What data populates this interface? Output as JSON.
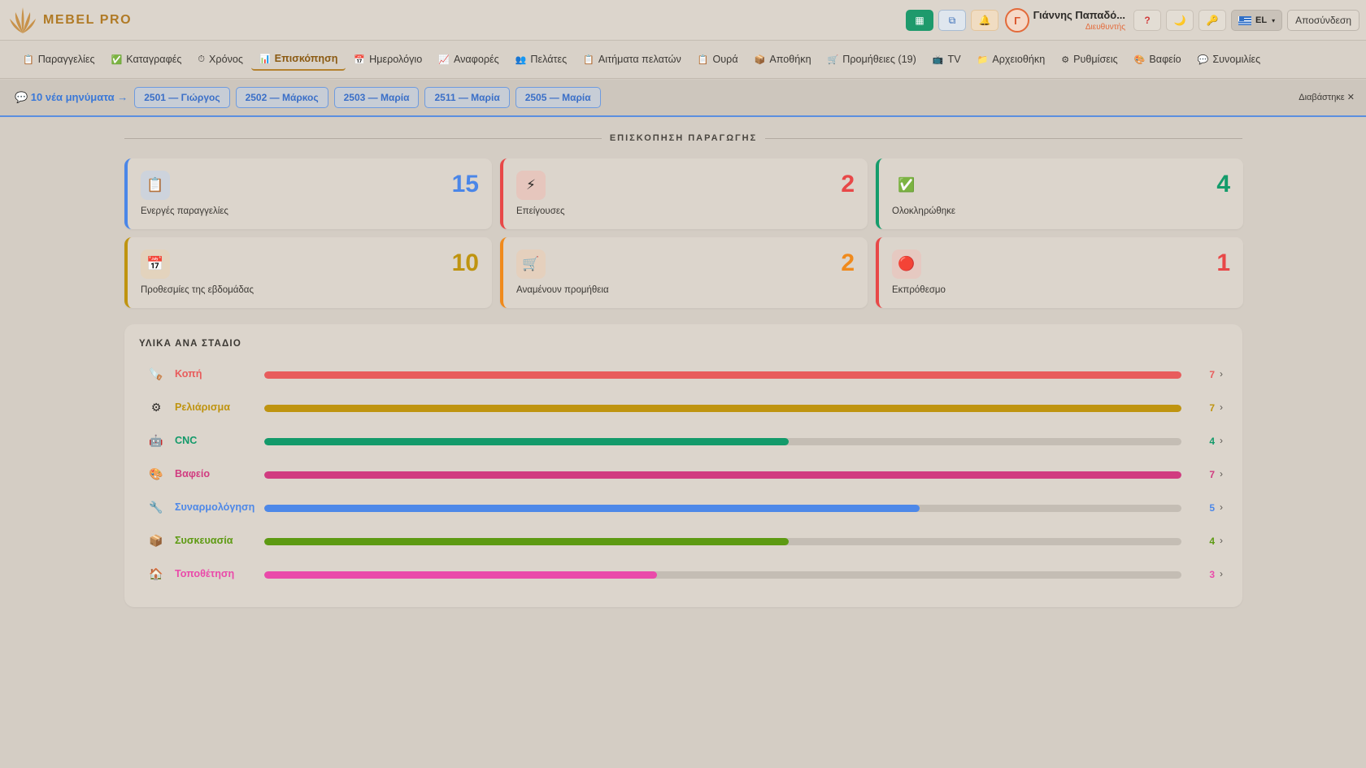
{
  "app": {
    "brand": "MEBEL PRO"
  },
  "header": {
    "buttons": [
      {
        "name": "shortcut-green-icon",
        "glyph": "▦"
      },
      {
        "name": "shortcut-blue-icon",
        "glyph": "⧉"
      },
      {
        "name": "notifications-icon",
        "glyph": "🔔"
      }
    ],
    "avatar_initial": "Γ",
    "user_name": "Γιάννης Παπαδό...",
    "user_role": "Διευθυντής",
    "help_glyph": "?",
    "theme_glyph": "🌙",
    "tools_glyph": "🔑",
    "lang": "EL",
    "logout": "Αποσύνδεση"
  },
  "nav": {
    "items": [
      {
        "label": "Παραγγελίες",
        "icon": "📋"
      },
      {
        "label": "Καταγραφές",
        "icon": "✅"
      },
      {
        "label": "Χρόνος",
        "icon": "⏱"
      },
      {
        "label": "Επισκόπηση",
        "icon": "📊"
      },
      {
        "label": "Ημερολόγιο",
        "icon": "📅"
      },
      {
        "label": "Αναφορές",
        "icon": "📈"
      },
      {
        "label": "Πελάτες",
        "icon": "👥"
      },
      {
        "label": "Αιτήματα πελατών",
        "icon": "📋"
      },
      {
        "label": "Ουρά",
        "icon": "📋"
      },
      {
        "label": "Αποθήκη",
        "icon": "📦"
      },
      {
        "label": "Προμήθειες (19)",
        "icon": "🛒"
      },
      {
        "label": "TV",
        "icon": "📺"
      },
      {
        "label": "Αρχειοθήκη",
        "icon": "📁"
      },
      {
        "label": "Ρυθμίσεις",
        "icon": "⚙"
      },
      {
        "label": "Βαφείο",
        "icon": "🎨"
      },
      {
        "label": "Συνομιλίες",
        "icon": "💬"
      }
    ],
    "active_index": 3
  },
  "messages": {
    "count_label": "💬 10 νέα μηνύματα →",
    "chips": [
      "2501 — Γιώργος",
      "2502 — Μάρκος",
      "2503 — Μαρία",
      "2511 — Μαρία",
      "2505 — Μαρία"
    ],
    "dismiss": "Διαβάστηκε ✕"
  },
  "overview": {
    "title": "ΕΠΙΣΚΟΠΗΣΗ ΠΑΡΑΓΩΓΗΣ",
    "cards": [
      {
        "label": "Ενεργές παραγγελίες",
        "value": "15",
        "icon": "📋",
        "color": "#4a86e8",
        "bg": "#cdd3dc"
      },
      {
        "label": "Επείγουσες",
        "value": "2",
        "icon": "⚡",
        "color": "#e84848",
        "bg": "#e6c6bd"
      },
      {
        "label": "Ολοκληρώθηκε",
        "value": "4",
        "icon": "✅",
        "color": "#149c6b",
        "bg": "#dcd5cc"
      },
      {
        "label": "Προθεσμίες της εβδομάδας",
        "value": "10",
        "icon": "📅",
        "color": "#bf9410",
        "bg": "#e3d3bd"
      },
      {
        "label": "Αναμένουν προμήθεια",
        "value": "2",
        "icon": "🛒",
        "color": "#f08a1c",
        "bg": "#e5d0bd"
      },
      {
        "label": "Εκπρόθεσμο",
        "value": "1",
        "icon": "🔴",
        "color": "#e84848",
        "bg": "#e6c9c1"
      }
    ]
  },
  "stages": {
    "title": "ΥΛΙΚΑ ΑΝΑ ΣΤΑΔΙΟ",
    "max": 7,
    "rows": [
      {
        "name": "Κοπή",
        "icon": "🪚",
        "count": 7,
        "color": "#e85c5c"
      },
      {
        "name": "Ρελιάρισμα",
        "icon": "⚙",
        "count": 7,
        "color": "#bf9410"
      },
      {
        "name": "CNC",
        "icon": "🤖",
        "count": 4,
        "color": "#139a6a"
      },
      {
        "name": "Βαφείο",
        "icon": "🎨",
        "count": 7,
        "color": "#d13c80"
      },
      {
        "name": "Συναρμολόγηση",
        "icon": "🔧",
        "count": 5,
        "color": "#4d88e8"
      },
      {
        "name": "Συσκευασία",
        "icon": "📦",
        "count": 4,
        "color": "#5d9a12"
      },
      {
        "name": "Τοποθέτηση",
        "icon": "🏠",
        "count": 3,
        "color": "#ea4aaa"
      }
    ]
  }
}
